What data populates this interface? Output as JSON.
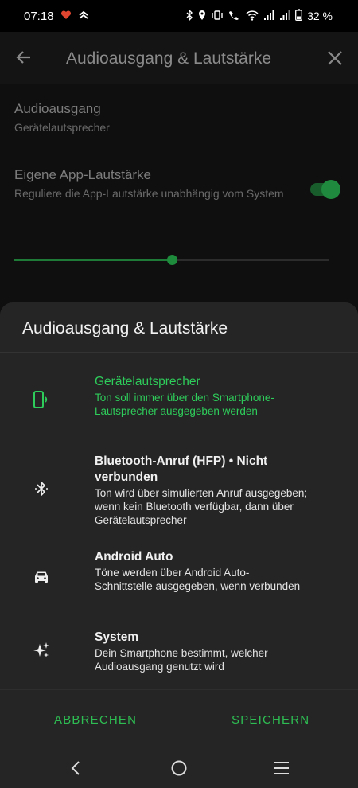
{
  "status_bar": {
    "time": "07:18",
    "battery": "32 %"
  },
  "appbar": {
    "title": "Audioausgang & Lautstärke"
  },
  "background": {
    "audio_output_title": "Audioausgang",
    "audio_output_value": "Gerätelautsprecher",
    "app_volume_title": "Eigene App-Lautstärke",
    "app_volume_desc": "Reguliere die App-Lautstärke unabhängig vom System",
    "app_volume_enabled": true,
    "volume_level": 0.5
  },
  "sheet": {
    "title": "Audioausgang & Lautstärke",
    "options": [
      {
        "icon": "phone-speaker-icon",
        "title": "Gerätelautsprecher",
        "desc": "Ton soll immer über den Smartphone-Lautsprecher ausgegeben werden",
        "selected": true
      },
      {
        "icon": "bluetooth-icon",
        "title": "Bluetooth-Anruf (HFP) • Nicht verbunden",
        "desc": "Ton wird über simulierten Anruf ausgegeben; wenn kein Bluetooth verfügbar, dann über Gerätelautsprecher",
        "selected": false
      },
      {
        "icon": "car-icon",
        "title": "Android Auto",
        "desc": "Töne werden über Android Auto-Schnittstelle ausgegeben, wenn verbunden",
        "selected": false
      },
      {
        "icon": "sparkle-icon",
        "title": "System",
        "desc": "Dein Smartphone bestimmt, welcher Audioausgang genutzt wird",
        "selected": false
      }
    ],
    "cancel_label": "ABBRECHEN",
    "save_label": "SPEICHERN"
  },
  "colors": {
    "accent": "#2ecc5a",
    "sheet_bg": "#252525"
  }
}
